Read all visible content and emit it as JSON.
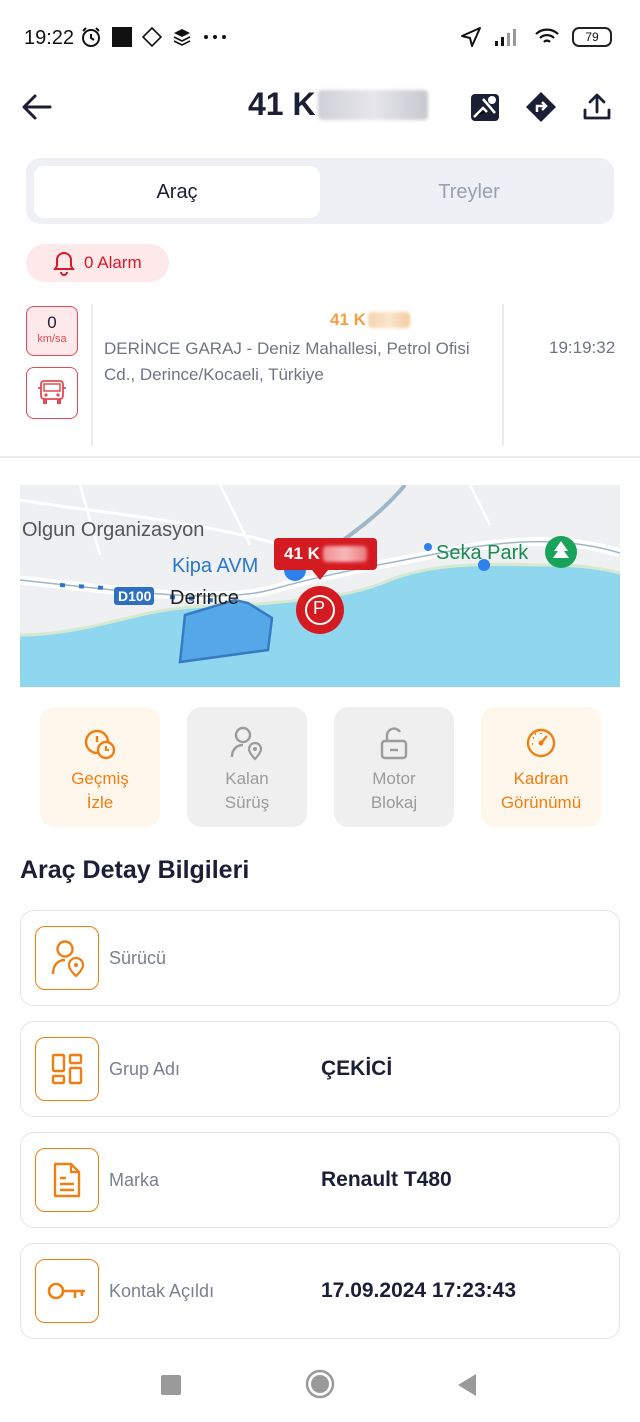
{
  "status_bar": {
    "time": "19:22",
    "battery": "79",
    "icons": [
      "alarm-clock-icon",
      "square-icon",
      "nav-diamond-icon",
      "layers-icon",
      "more-dots-icon",
      "location-arrow-icon",
      "signal-icon",
      "wifi-icon",
      "battery-icon"
    ]
  },
  "header": {
    "title_visible": "41 K",
    "actions": [
      "map-toggle-icon",
      "directions-icon",
      "share-icon"
    ]
  },
  "tabs": [
    {
      "label": "Araç",
      "active": true
    },
    {
      "label": "Treyler",
      "active": false
    }
  ],
  "alarm": {
    "label": "0 Alarm"
  },
  "vehicle": {
    "speed": "0",
    "speed_unit": "km/sa",
    "plate_visible": "41 K",
    "address": "DERİNCE GARAJ - Deniz Mahallesi, Petrol Ofisi Cd., Derince/Kocaeli, Türkiye",
    "time": "19:19:32"
  },
  "map": {
    "labels": {
      "olgun": "Olgun Organizasyon",
      "kipa": "Kipa AVM",
      "derince": "Derince",
      "road": "D100",
      "seka": "Seka Park"
    },
    "marker_plate": "41 K",
    "parking_symbol": "P"
  },
  "actions": [
    {
      "line1": "Geçmiş",
      "line2": "İzle",
      "style": "orange",
      "icon": "history-clock-icon"
    },
    {
      "line1": "Kalan",
      "line2": "Sürüş",
      "style": "gray",
      "icon": "remaining-drive-icon"
    },
    {
      "line1": "Motor",
      "line2": "Blokaj",
      "style": "gray",
      "icon": "unlock-icon"
    },
    {
      "line1": "Kadran",
      "line2": "Görünümü",
      "style": "orange",
      "icon": "gauge-icon"
    }
  ],
  "details": {
    "title": "Araç Detay Bilgileri",
    "rows": [
      {
        "label": "Sürücü",
        "value": "",
        "icon": "driver-location-icon"
      },
      {
        "label": "Grup Adı",
        "value": "ÇEKİCİ",
        "icon": "group-grid-icon"
      },
      {
        "label": "Marka",
        "value": "Renault T480",
        "icon": "document-icon"
      },
      {
        "label": "Kontak Açıldı",
        "value": "17.09.2024 17:23:43",
        "icon": "key-icon"
      }
    ]
  },
  "nav": [
    "recent-apps-icon",
    "home-icon",
    "back-triangle-icon"
  ],
  "colors": {
    "accent_orange": "#ee7f12",
    "alarm_red": "#d8192a",
    "marker_red": "#d41b22",
    "text_dark": "#1a1f36"
  }
}
